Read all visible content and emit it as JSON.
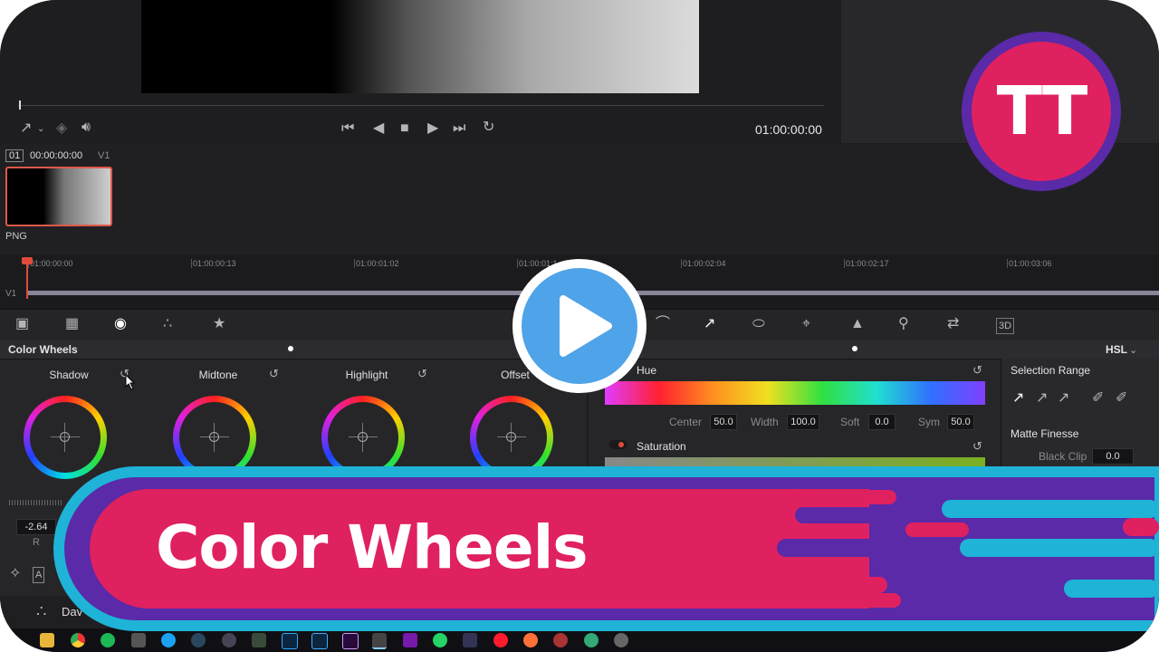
{
  "viewer": {
    "timecode": "01:00:00:00"
  },
  "clip": {
    "number": "01",
    "timecode": "00:00:00:00",
    "track": "V1",
    "format": "PNG"
  },
  "timeline": {
    "ticks": [
      "01:00:00:00",
      "01:00:00:13",
      "01:00:01:02",
      "01:00:01:1",
      "01:00:02:04",
      "01:00:02:17",
      "01:00:03:06"
    ],
    "track_label": "V1"
  },
  "color_wheels": {
    "panel_title": "Color Wheels",
    "wheels": [
      "Shadow",
      "Midtone",
      "Highlight",
      "Offset"
    ],
    "value": "-2.64",
    "channel": "R"
  },
  "qualifier": {
    "mode": "HSL",
    "hue_label": "Hue",
    "center_label": "Center",
    "center_value": "50.0",
    "width_label": "Width",
    "width_value": "100.0",
    "soft_label": "Soft",
    "soft_value": "0.0",
    "sym_label": "Sym",
    "sym_value": "50.0",
    "saturation_label": "Saturation",
    "selection_range_label": "Selection Range",
    "matte_finesse_label": "Matte Finesse",
    "black_clip_label": "Black Clip",
    "black_clip_value": "0.0"
  },
  "app": {
    "name_partial": "Dav"
  },
  "overlay": {
    "title": "Color Wheels",
    "logo_text": "TT",
    "colors": {
      "pink": "#e0215f",
      "purple": "#5a2aa8",
      "cyan": "#1fb3d8",
      "play": "#4fa3e8"
    }
  }
}
